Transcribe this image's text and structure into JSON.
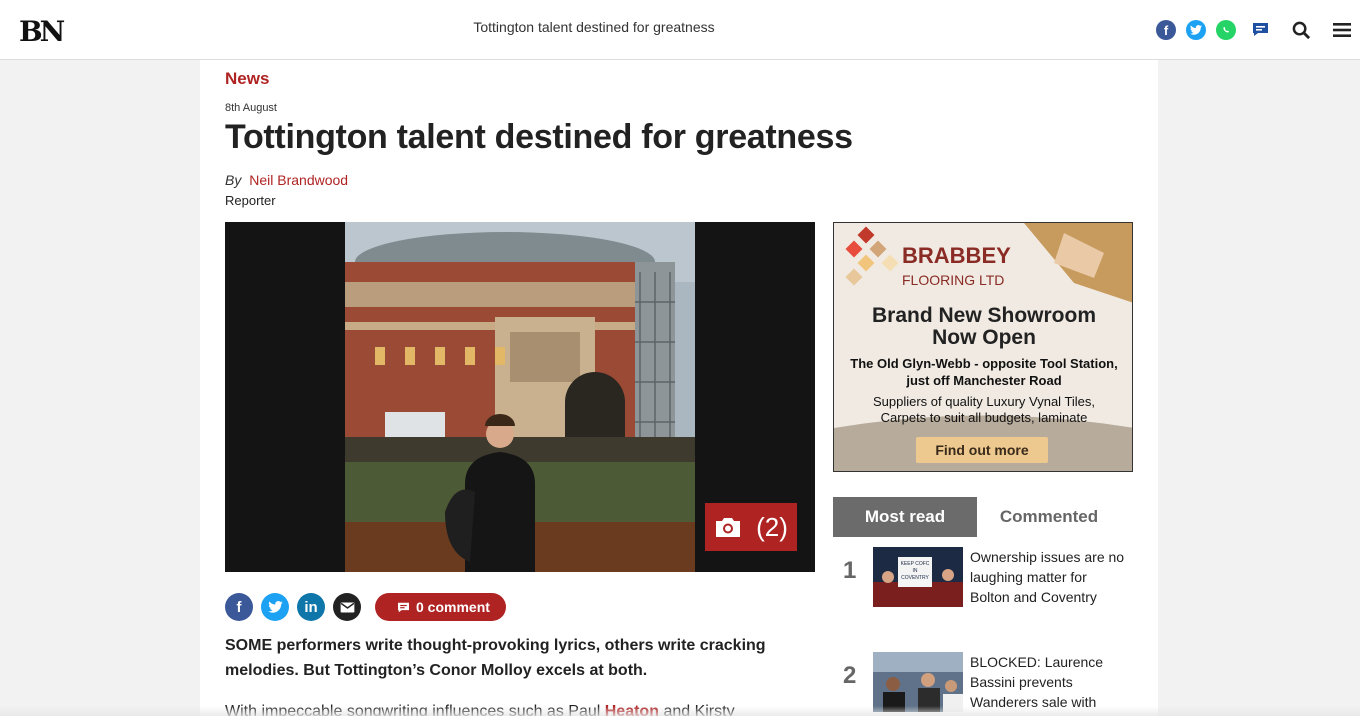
{
  "header": {
    "logo": "BN",
    "title": "Tottington talent destined for greatness",
    "share_icons": [
      "facebook-icon",
      "twitter-icon",
      "whatsapp-icon",
      "comment-icon"
    ],
    "search_icon": "search-icon",
    "menu_icon": "menu-icon"
  },
  "article": {
    "section": "News",
    "date": "8th August",
    "headline": "Tottington talent destined for greatness",
    "by": "By",
    "author": "Neil Brandwood",
    "role": "Reporter",
    "gallery_count": "(2)",
    "comment_label": "0 comment",
    "lead": "SOME performers write thought-provoking lyrics, others write cracking melodies. But Tottington’s Conor Molloy excels at both.",
    "body_start": "With impeccable songwriting influences such as Paul",
    "body_link": "Heaton",
    "body_end": "and Kirsty"
  },
  "ad": {
    "brand": "BRABBEY",
    "brand_sub": "FLOORING LTD",
    "headline_1": "Brand New Showroom",
    "headline_2": "Now Open",
    "line_1": "The Old Glyn-Webb - opposite Tool Station,",
    "line_2": "just off Manchester Road",
    "line_3": "Suppliers of quality Luxury Vynal Tiles,",
    "line_4": "Carpets to suit all budgets, laminate",
    "cta": "Find out more"
  },
  "most_read": {
    "tab_active": "Most read",
    "tab_other": "Commented",
    "items": [
      {
        "rank": "1",
        "title": "Ownership issues are no laughing matter for Bolton and Coventry",
        "sign": "KEEP COFC IN COVENTRY"
      },
      {
        "rank": "2",
        "title": "BLOCKED: Laurence Bassini prevents Wanderers sale with court injunction"
      }
    ]
  },
  "colors": {
    "accent": "#b02323",
    "facebook": "#3b5998",
    "twitter": "#1da1f2",
    "whatsapp": "#25d366",
    "linkedin": "#0e76a8"
  }
}
